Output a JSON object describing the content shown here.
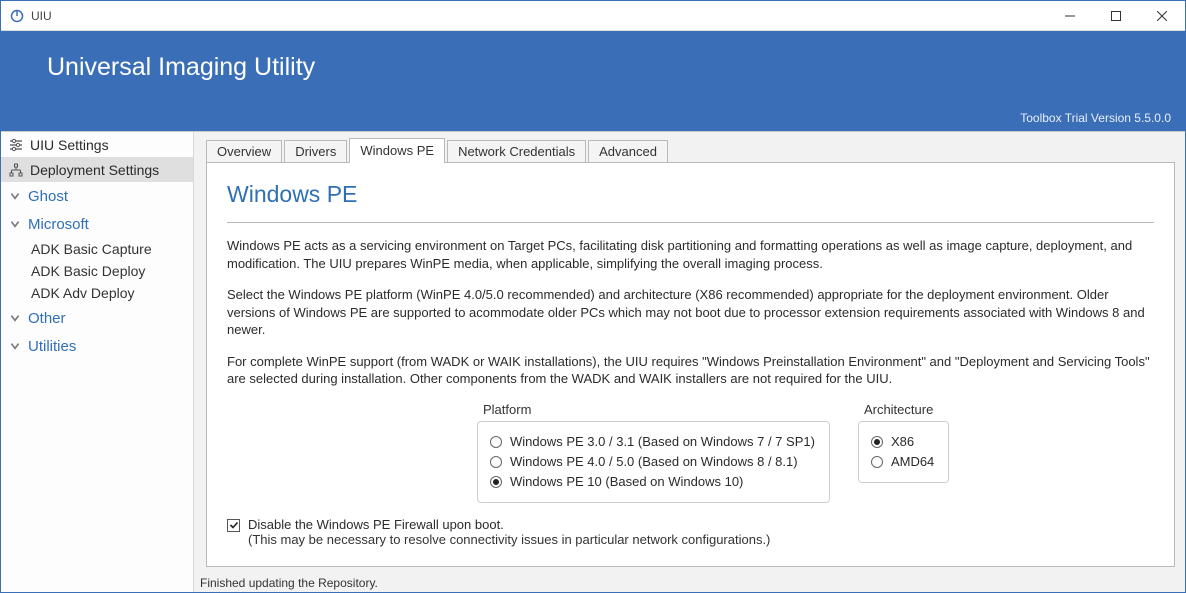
{
  "window": {
    "title": "UIU"
  },
  "banner": {
    "title": "Universal Imaging Utility",
    "version": "Toolbox Trial Version 5.5.0.0"
  },
  "sidebar": {
    "rows": [
      {
        "label": "UIU Settings"
      },
      {
        "label": "Deployment Settings"
      }
    ],
    "cats": {
      "ghost": "Ghost",
      "microsoft": "Microsoft",
      "other": "Other",
      "utilities": "Utilities"
    },
    "ms_items": [
      "ADK Basic Capture",
      "ADK Basic Deploy",
      "ADK Adv Deploy"
    ]
  },
  "tabs": [
    "Overview",
    "Drivers",
    "Windows PE",
    "Network Credentials",
    "Advanced"
  ],
  "page": {
    "heading": "Windows PE",
    "p1": "Windows PE acts as a servicing environment on Target PCs, facilitating disk partitioning and formatting operations as well as image capture, deployment, and modification. The UIU prepares WinPE media, when applicable, simplifying the overall imaging process.",
    "p2": "Select the Windows PE platform (WinPE 4.0/5.0 recommended) and architecture (X86 recommended) appropriate for the deployment environment. Older versions of Windows PE are supported to acommodate older PCs which may not boot due to processor extension requirements associated with Windows 8 and newer.",
    "p3": "For complete WinPE support (from WADK or WAIK installations), the UIU requires \"Windows Preinstallation Environment\" and \"Deployment and Servicing Tools\" are selected during installation. Other components from the WADK and WAIK installers are not required for the UIU.",
    "platform_label": "Platform",
    "platform_opts": [
      "Windows PE 3.0 / 3.1 (Based on Windows 7 / 7 SP1)",
      "Windows PE 4.0 / 5.0 (Based on Windows 8 / 8.1)",
      "Windows PE 10 (Based on Windows 10)"
    ],
    "arch_label": "Architecture",
    "arch_opts": [
      "X86",
      "AMD64"
    ],
    "firewall_label": "Disable the Windows PE Firewall upon boot.",
    "firewall_hint": "(This may be necessary to resolve connectivity issues in particular network configurations.)"
  },
  "status": "Finished updating the Repository."
}
